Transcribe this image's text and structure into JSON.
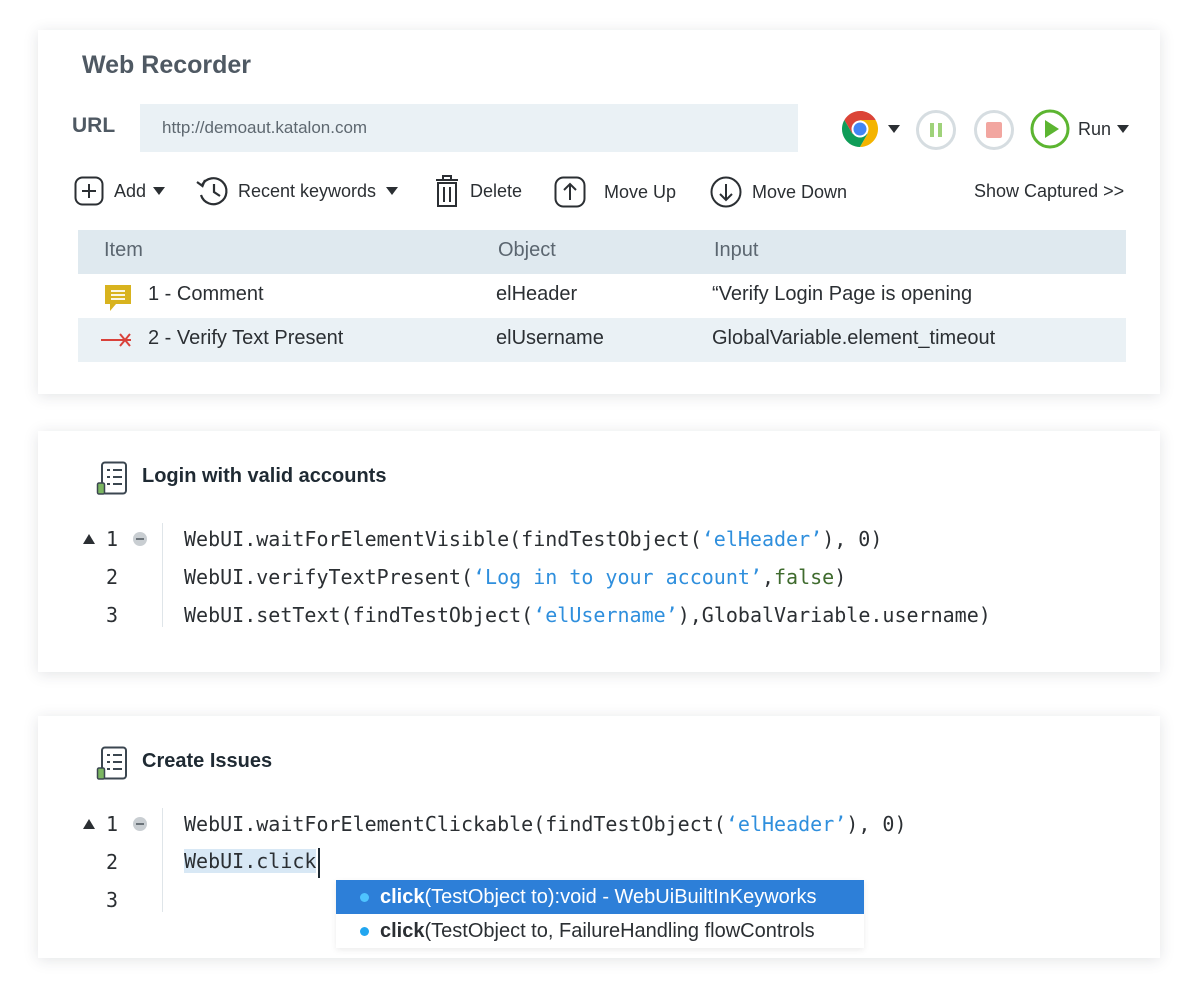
{
  "recorder": {
    "title": "Web Recorder",
    "url_label": "URL",
    "url_value": "http://demoaut.katalon.com",
    "run_label": "Run",
    "toolbar": {
      "add": "Add",
      "recent": "Recent keywords",
      "delete": "Delete",
      "move_up": "Move Up",
      "move_down": "Move Down",
      "show_captured": "Show Captured >>"
    },
    "columns": [
      "Item",
      "Object",
      "Input"
    ],
    "rows": [
      {
        "item": "1 - Comment",
        "object": "elHeader",
        "input": "“Verify Login Page is opening",
        "icon": "comment-icon"
      },
      {
        "item": "2 - Verify Text Present",
        "object": "elUsername",
        "input": "GlobalVariable.element_timeout",
        "icon": "verify-arrow-icon"
      }
    ]
  },
  "scripts": [
    {
      "title": "Login with valid accounts",
      "line_numbers": [
        "1",
        "2",
        "3"
      ],
      "lines": [
        {
          "a": "WebUI.waitForElementVisible(findTestObject(",
          "s": "‘elHeader’",
          "b": "), 0)"
        },
        {
          "a": "WebUI.verifyTextPresent(",
          "s": "‘Log in to your account’",
          "m": ",",
          "k": "false",
          "b": ")"
        },
        {
          "a": "WebUI.setText(findTestObject(",
          "s": "‘elUsername’",
          "b": "),GlobalVariable.username)"
        }
      ]
    },
    {
      "title": "Create Issues",
      "line_numbers": [
        "1",
        "2",
        "3"
      ],
      "lines": [
        {
          "a": "WebUI.waitForElementClickable(findTestObject(",
          "s": "‘elHeader’",
          "b": "), 0)"
        },
        {
          "a": "WebUI.click"
        }
      ],
      "autocomplete": [
        {
          "name": "click",
          "rest": "(TestObject to):void - WebUiBuiltInKeyworks"
        },
        {
          "name": "click",
          "rest": "(TestObject to, FailureHandling flowControls"
        }
      ]
    }
  ],
  "colors": {
    "string": "#2f8fdd",
    "keyword": "#3f6b2e",
    "autocomplete_selected": "#2d7fd8",
    "run_green": "#5cb531",
    "pause_green": "#9fd27a",
    "stop_red": "#f2a6a0"
  }
}
